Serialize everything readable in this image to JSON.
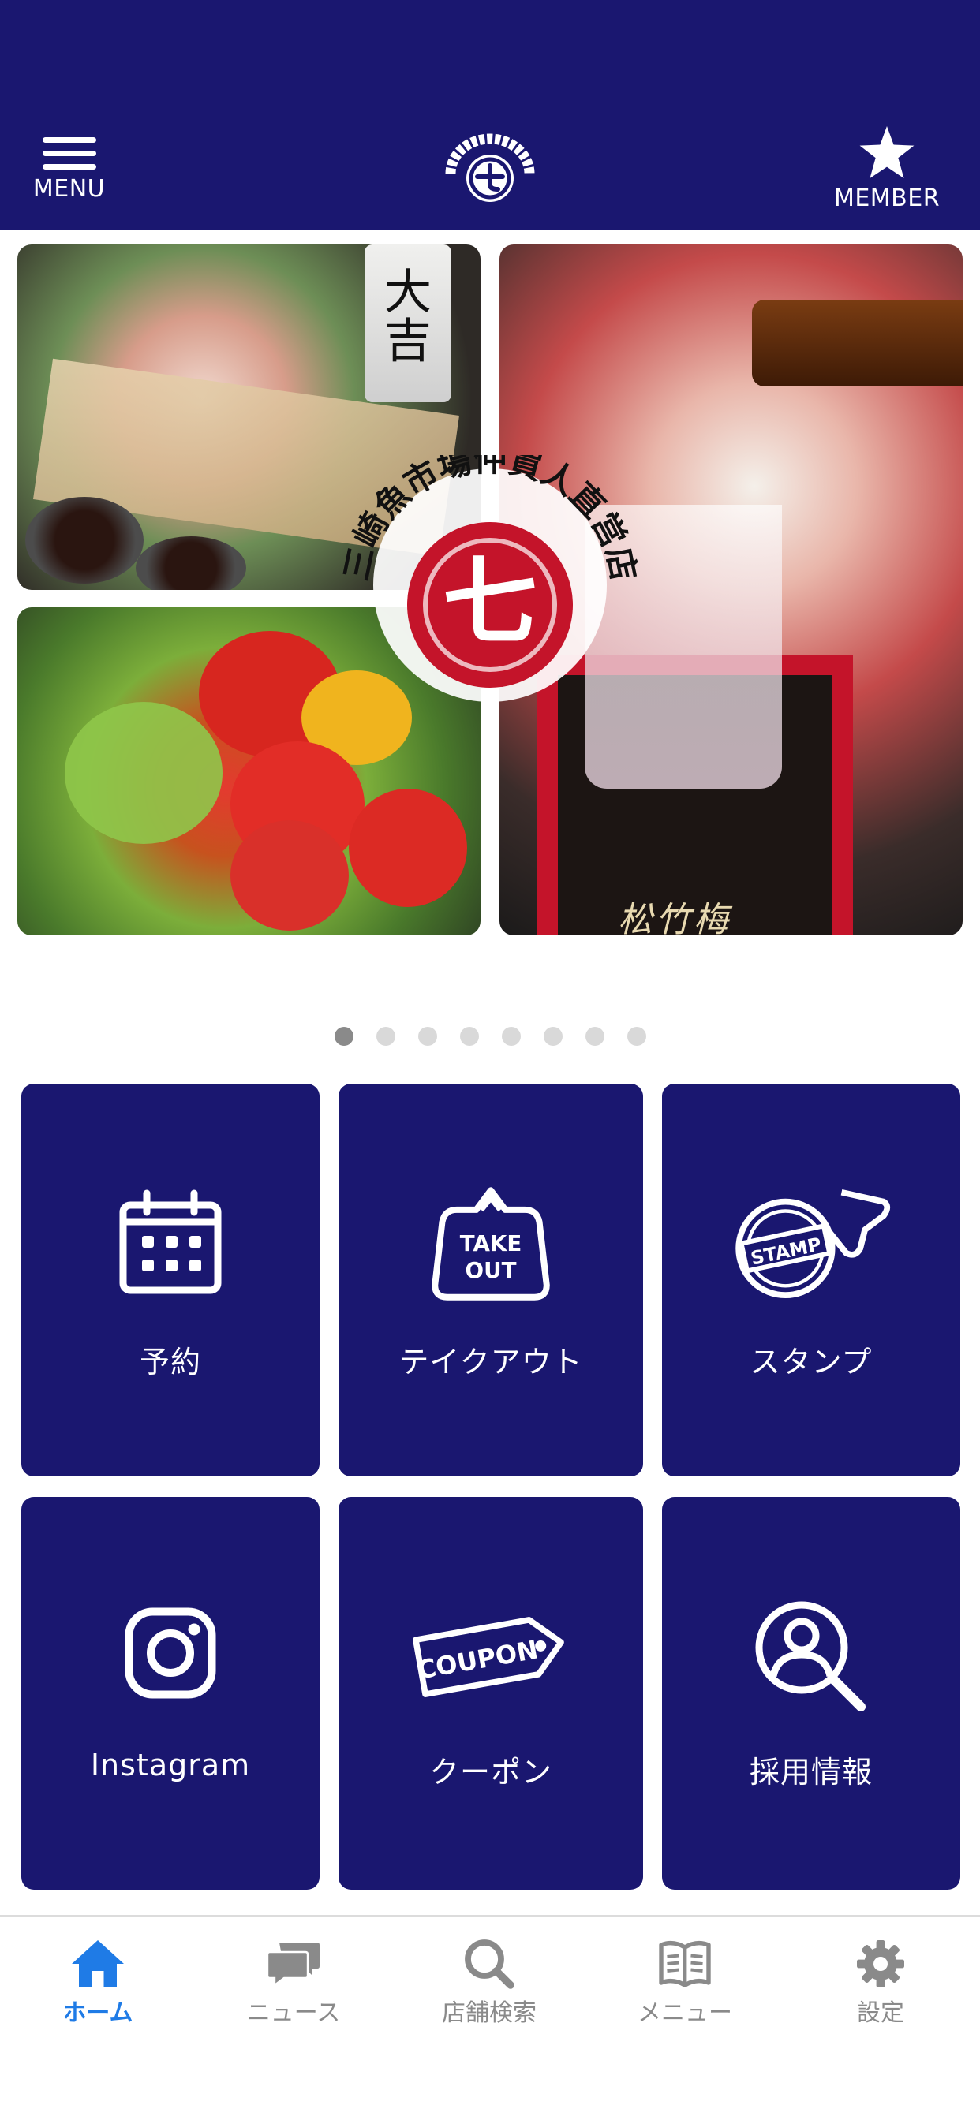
{
  "header": {
    "menu_label": "MENU",
    "member_label": "MEMBER",
    "background": "#1a1770"
  },
  "hero": {
    "box_text": "松竹梅",
    "bottle_text": "大吉",
    "seal_text": "三崎魚市場仲買人直営店",
    "seal_char": "七"
  },
  "carousel": {
    "pages": 8,
    "current": 1
  },
  "grid": [
    {
      "label": "予約",
      "icon": "calendar-icon"
    },
    {
      "label": "テイクアウト",
      "icon": "takeout-icon",
      "icon_text_1": "TAKE",
      "icon_text_2": "OUT"
    },
    {
      "label": "スタンプ",
      "icon": "stamp-icon",
      "icon_text": "STAMP"
    },
    {
      "label": "Instagram",
      "icon": "instagram-icon"
    },
    {
      "label": "クーポン",
      "icon": "coupon-icon",
      "icon_text": "COUPON"
    },
    {
      "label": "採用情報",
      "icon": "recruit-search-icon"
    }
  ],
  "tabbar": [
    {
      "label": "ホーム",
      "icon": "home-icon",
      "active": true
    },
    {
      "label": "ニュース",
      "icon": "news-icon",
      "active": false
    },
    {
      "label": "店舗検索",
      "icon": "store-search-icon",
      "active": false
    },
    {
      "label": "メニュー",
      "icon": "menu-book-icon",
      "active": false
    },
    {
      "label": "設定",
      "icon": "settings-icon",
      "active": false
    }
  ],
  "colors": {
    "primary": "#1a1770",
    "accent": "#1f7be6",
    "inactive": "#8a8a8a",
    "seal_red": "#c4142a"
  }
}
